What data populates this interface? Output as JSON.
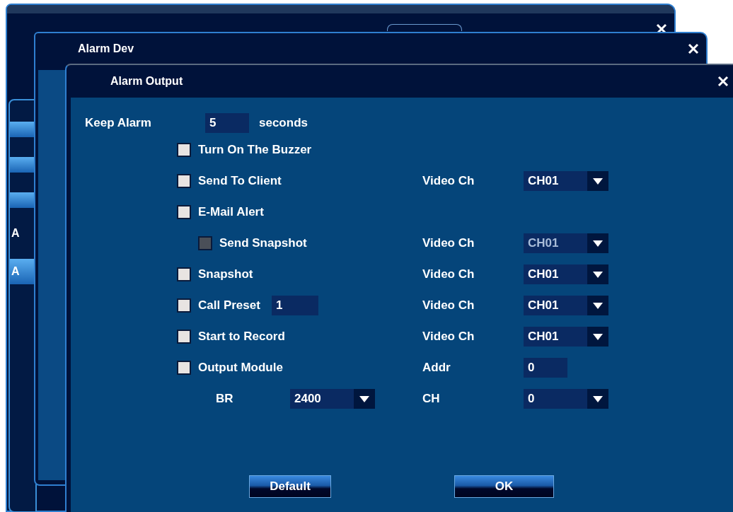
{
  "outer_window": {
    "sidebar_items": [
      {
        "label": "A",
        "selected": false
      },
      {
        "label": "A",
        "selected": true
      }
    ]
  },
  "alarm_dev_window": {
    "title": "Alarm Dev"
  },
  "alarm_output_dialog": {
    "title": "Alarm Output",
    "keep_alarm": {
      "label": "Keep Alarm",
      "value": "5",
      "unit": "seconds"
    },
    "options": [
      {
        "kind": "checkbox",
        "label": "Turn On The Buzzer",
        "checked": false,
        "disabled": false
      },
      {
        "kind": "checkbox",
        "label": "Send To Client",
        "checked": false,
        "disabled": false,
        "channel": {
          "label": "Video Ch",
          "value": "CH01"
        }
      },
      {
        "kind": "checkbox",
        "label": "E-Mail Alert",
        "checked": false,
        "disabled": false,
        "children": [
          {
            "kind": "checkbox",
            "label": "Send Snapshot",
            "checked": false,
            "disabled": true,
            "channel": {
              "label": "Video Ch",
              "value": "CH01"
            }
          }
        ]
      },
      {
        "kind": "checkbox",
        "label": "Snapshot",
        "checked": false,
        "disabled": false,
        "channel": {
          "label": "Video Ch",
          "value": "CH01"
        }
      },
      {
        "kind": "checkbox",
        "label": "Call Preset",
        "checked": false,
        "disabled": false,
        "preset": "1",
        "channel": {
          "label": "Video Ch",
          "value": "CH01"
        }
      },
      {
        "kind": "checkbox",
        "label": "Start to Record",
        "checked": false,
        "disabled": false,
        "channel": {
          "label": "Video Ch",
          "value": "CH01"
        }
      },
      {
        "kind": "checkbox",
        "label": "Output Module",
        "checked": false,
        "disabled": false,
        "address": {
          "label": "Addr",
          "value": "0"
        },
        "children": [
          {
            "kind": "select",
            "label": "BR",
            "value": "2400",
            "disabled": false,
            "channel": {
              "label": "CH",
              "value": "0"
            }
          }
        ]
      }
    ],
    "buttons": [
      "Default",
      "OK"
    ]
  }
}
